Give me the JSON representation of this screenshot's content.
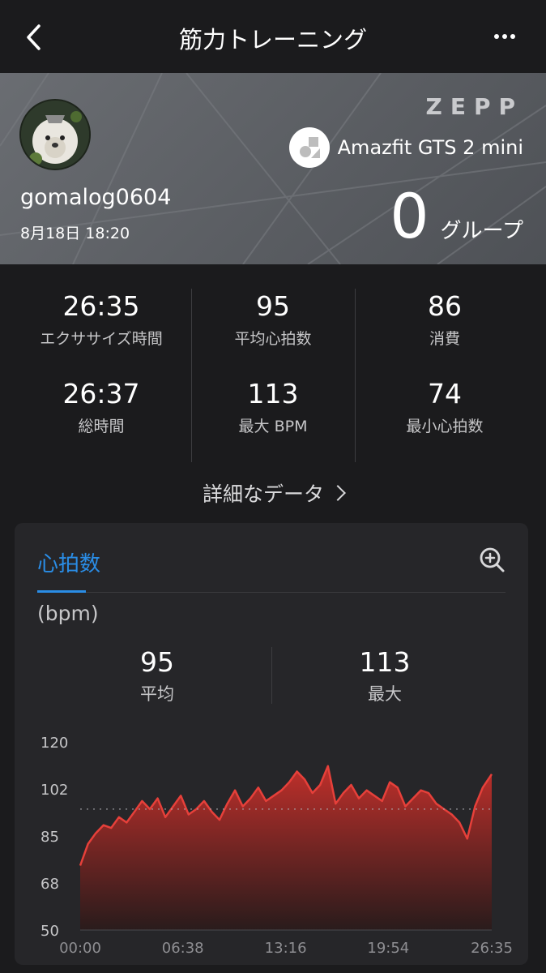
{
  "nav": {
    "title": "筋力トレーニング"
  },
  "hero": {
    "brand": "ZEPP",
    "device": "Amazfit GTS 2 mini",
    "username": "gomalog0604",
    "datetime": "8月18日 18:20",
    "groups": "0",
    "groups_unit": "グループ"
  },
  "stats": [
    {
      "value": "26:35",
      "label": "エクササイズ時間"
    },
    {
      "value": "95",
      "label": "平均心拍数"
    },
    {
      "value": "86",
      "label": "消費"
    },
    {
      "value": "26:37",
      "label": "総時間"
    },
    {
      "value": "113",
      "label": "最大 BPM"
    },
    {
      "value": "74",
      "label": "最小心拍数"
    }
  ],
  "detail_link": "詳細なデータ",
  "heart_card": {
    "tab": "心拍数",
    "unit": "(bpm)",
    "avg": {
      "value": "95",
      "label": "平均"
    },
    "max": {
      "value": "113",
      "label": "最大"
    }
  },
  "colors": {
    "accent": "#2a8de6",
    "line": "#e6403a",
    "background": "#1b1b1d",
    "card": "#262629"
  },
  "chart_data": {
    "type": "area",
    "ylabel": "(bpm)",
    "y_ticks": [
      "120",
      "102",
      "85",
      "68",
      "50"
    ],
    "ylim": [
      50,
      120
    ],
    "x_ticks": [
      "00:00",
      "06:38",
      "13:16",
      "19:54",
      "26:35"
    ],
    "x_tick_minutes": [
      0,
      6.63,
      13.27,
      19.9,
      26.58
    ],
    "xlim": [
      0,
      26.58
    ],
    "average_line": 95,
    "x": [
      0,
      0.5,
      1,
      1.5,
      2,
      2.5,
      3,
      3.5,
      4,
      4.5,
      5,
      5.5,
      6,
      6.5,
      7,
      7.5,
      8,
      8.5,
      9,
      9.5,
      10,
      10.5,
      11,
      11.5,
      12,
      12.5,
      13,
      13.5,
      14,
      14.5,
      15,
      15.5,
      16,
      16.5,
      17,
      17.5,
      18,
      18.5,
      19,
      19.5,
      20,
      20.5,
      21,
      21.5,
      22,
      22.5,
      23,
      23.5,
      24,
      24.5,
      25,
      25.5,
      26,
      26.58
    ],
    "y": [
      74,
      82,
      86,
      89,
      88,
      92,
      90,
      94,
      98,
      95,
      99,
      92,
      96,
      100,
      93,
      95,
      98,
      94,
      91,
      97,
      102,
      96,
      99,
      103,
      98,
      100,
      102,
      105,
      109,
      106,
      101,
      104,
      111,
      97,
      101,
      104,
      99,
      102,
      100,
      98,
      105,
      103,
      96,
      99,
      102,
      101,
      97,
      95,
      93,
      90,
      84,
      96,
      103,
      108
    ]
  }
}
